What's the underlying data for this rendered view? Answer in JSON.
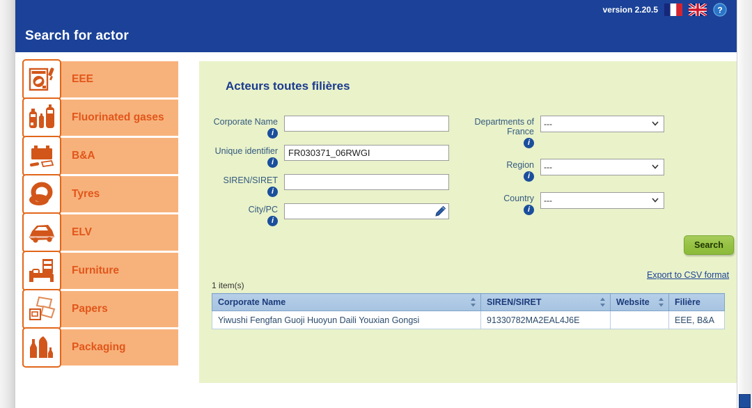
{
  "header": {
    "title": "Search for actor",
    "version": "version 2.20.5",
    "flag_fr": "french-flag-icon",
    "flag_uk": "uk-flag-icon",
    "help": "help-icon"
  },
  "sidebar": {
    "items": [
      {
        "label": "EEE",
        "icon": "washing-machine-icon"
      },
      {
        "label": "Fluorinated gases",
        "icon": "gas-cylinders-icon"
      },
      {
        "label": "B&A",
        "icon": "battery-icon"
      },
      {
        "label": "Tyres",
        "icon": "tyre-icon"
      },
      {
        "label": "ELV",
        "icon": "car-icon"
      },
      {
        "label": "Furniture",
        "icon": "furniture-icon"
      },
      {
        "label": "Papers",
        "icon": "papers-icon"
      },
      {
        "label": "Packaging",
        "icon": "packaging-icon"
      }
    ]
  },
  "panel": {
    "title": "Acteurs toutes filières",
    "fields_left": [
      {
        "label": "Corporate Name",
        "value": "",
        "placeholder": ""
      },
      {
        "label": "Unique identifier",
        "value": "FR030371_06RWGI",
        "placeholder": ""
      },
      {
        "label": "SIREN/SIRET",
        "value": "",
        "placeholder": ""
      },
      {
        "label": "City/PC",
        "value": "",
        "placeholder": ""
      }
    ],
    "fields_right": [
      {
        "label": "Departments of France",
        "value": "---"
      },
      {
        "label": "Region",
        "value": "---"
      },
      {
        "label": "Country",
        "value": "---"
      }
    ],
    "search_button": "Search",
    "csv_link": "Export to CSV format",
    "item_count": "1 item(s)"
  },
  "table": {
    "columns": [
      "Corporate Name",
      "SIREN/SIRET",
      "Website",
      "Filière"
    ],
    "rows": [
      {
        "corporate_name": "Yiwushi Fengfan Guoji Huoyun Daili Youxian Gongsi",
        "siren_siret": "91330782MA2EAL4J6E",
        "website": "",
        "filiere": "EEE, B&A"
      }
    ]
  },
  "colors": {
    "header_blue": "#1b4298",
    "panel_green": "#e9f2c9",
    "sidebar_orange": "#f7b27c",
    "orange_text": "#e2561a",
    "search_green": "#96c244",
    "table_header": "#a6c3e1"
  }
}
